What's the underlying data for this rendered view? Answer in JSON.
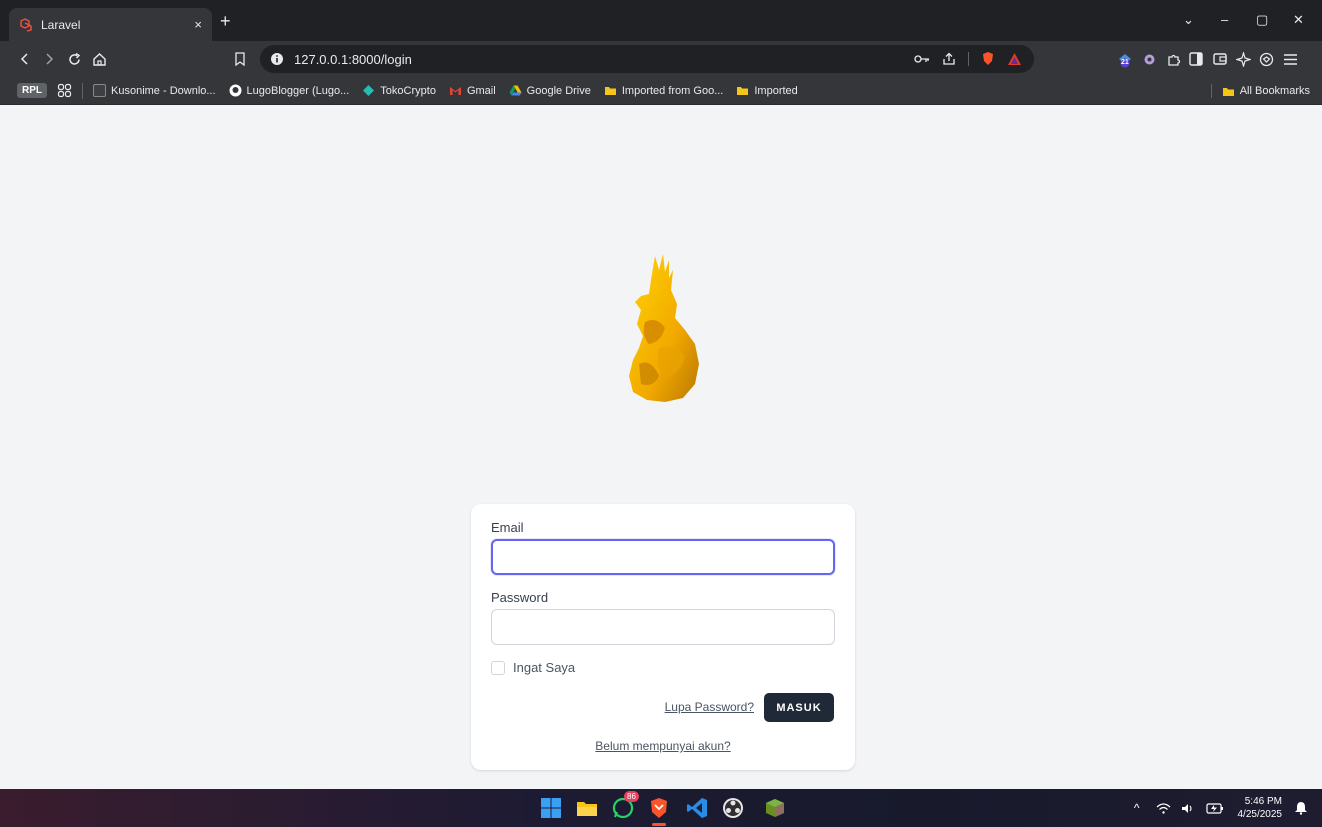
{
  "browser": {
    "tab_title": "Laravel",
    "tab_close": "×",
    "new_tab": "+",
    "url": "127.0.0.1:8000/login",
    "win_controls": [
      "⌄",
      "–",
      "▢",
      "✕"
    ]
  },
  "bookmarks": {
    "group_label": "RPL",
    "items": [
      {
        "label": "Kusonime - Downlo...",
        "color": "#3c4043"
      },
      {
        "label": "LugoBlogger (Lugo...",
        "color": "#ffffff"
      },
      {
        "label": "TokoCrypto",
        "color": "#1fbfb5"
      },
      {
        "label": "Gmail",
        "color": "#ea4335"
      },
      {
        "label": "Google Drive",
        "color": "#fbbc04"
      },
      {
        "label": "Imported from Goo...",
        "color": "#f5c518"
      },
      {
        "label": "Imported",
        "color": "#f5c518"
      }
    ],
    "all_bookmarks": "All Bookmarks"
  },
  "extensions": {
    "badge_count": "21"
  },
  "login": {
    "email_label": "Email",
    "email_value": "",
    "password_label": "Password",
    "password_value": "",
    "remember_label": "Ingat Saya",
    "forgot_link": "Lupa Password?",
    "submit_label": "MASUK",
    "register_link": "Belum mempunyai akun?"
  },
  "taskbar": {
    "whatsapp_badge": "86",
    "time": "5:46 PM",
    "date": "4/25/2025"
  },
  "colors": {
    "accent": "#6366f1",
    "button": "#1f2937",
    "logo": "#f5b800"
  }
}
